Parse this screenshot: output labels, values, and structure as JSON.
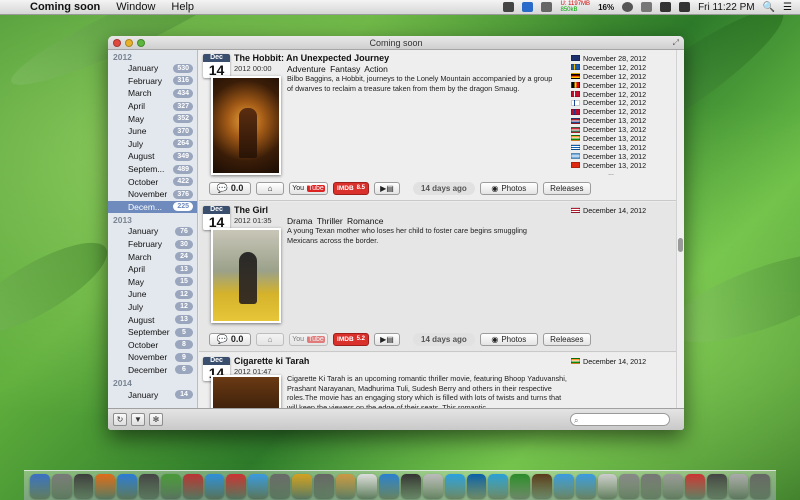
{
  "menubar": {
    "app_name": "Coming soon",
    "menus": [
      "Window",
      "Help"
    ],
    "net_up": "U: 1197MB",
    "net_down": "850kB",
    "battery": "16%",
    "clock": "Fri 11:22 PM"
  },
  "window": {
    "title": "Coming soon"
  },
  "sidebar": {
    "groups": [
      {
        "year": "2012",
        "months": [
          {
            "label": "January",
            "count": "530"
          },
          {
            "label": "February",
            "count": "316"
          },
          {
            "label": "March",
            "count": "434"
          },
          {
            "label": "April",
            "count": "327"
          },
          {
            "label": "May",
            "count": "352"
          },
          {
            "label": "June",
            "count": "370"
          },
          {
            "label": "July",
            "count": "264"
          },
          {
            "label": "August",
            "count": "349"
          },
          {
            "label": "Septem...",
            "count": "489"
          },
          {
            "label": "October",
            "count": "422"
          },
          {
            "label": "November",
            "count": "376"
          },
          {
            "label": "Decem...",
            "count": "225",
            "selected": true
          }
        ]
      },
      {
        "year": "2013",
        "months": [
          {
            "label": "January",
            "count": "76"
          },
          {
            "label": "February",
            "count": "30"
          },
          {
            "label": "March",
            "count": "24"
          },
          {
            "label": "April",
            "count": "13"
          },
          {
            "label": "May",
            "count": "15"
          },
          {
            "label": "June",
            "count": "12"
          },
          {
            "label": "July",
            "count": "12"
          },
          {
            "label": "August",
            "count": "13"
          },
          {
            "label": "September",
            "count": "5"
          },
          {
            "label": "October",
            "count": "8"
          },
          {
            "label": "November",
            "count": "9"
          },
          {
            "label": "December",
            "count": "6"
          }
        ]
      },
      {
        "year": "2014",
        "months": [
          {
            "label": "January",
            "count": "14"
          }
        ]
      }
    ]
  },
  "movies": [
    {
      "month": "Dec",
      "day": "14",
      "title": "The Hobbit: An Unexpected Journey",
      "datetime": "2012 00:00",
      "genres": "Adventure  Fantasy  Action",
      "description": "Bilbo Baggins, a Hobbit, journeys to the Lonely Mountain accompanied by a group of dwarves to reclaim a treasure taken from them by the dragon Smaug.",
      "rating": "0.0",
      "imdb_label": "IMDB",
      "imdb_score": "8.5",
      "days": "14 days ago",
      "photos_label": "Photos",
      "releases_label": "Releases",
      "youtube_you": "You",
      "youtube_tube": "Tube",
      "more": "...",
      "releases": [
        {
          "date": "November 28, 2012",
          "flag": "nz"
        },
        {
          "date": "December 12, 2012",
          "flag": "se"
        },
        {
          "date": "December 12, 2012",
          "flag": "de"
        },
        {
          "date": "December 12, 2012",
          "flag": "be"
        },
        {
          "date": "December 12, 2012",
          "flag": "dk"
        },
        {
          "date": "December 12, 2012",
          "flag": "fi"
        },
        {
          "date": "December 12, 2012",
          "flag": "no"
        },
        {
          "date": "December 13, 2012",
          "flag": "nl"
        },
        {
          "date": "December 13, 2012",
          "flag": "hu"
        },
        {
          "date": "December 13, 2012",
          "flag": "in"
        },
        {
          "date": "December 13, 2012",
          "flag": "gr"
        },
        {
          "date": "December 13, 2012",
          "flag": "ar"
        },
        {
          "date": "December 13, 2012",
          "flag": "hk"
        }
      ]
    },
    {
      "month": "Dec",
      "day": "14",
      "title": "The Girl",
      "datetime": "2012 01:35",
      "genres": "Drama  Thriller  Romance",
      "description": "A young Texan mother who loses her child to foster care begins smuggling Mexicans across the border.",
      "rating": "0.0",
      "imdb_label": "IMDB",
      "imdb_score": "5.2",
      "days": "14 days ago",
      "photos_label": "Photos",
      "releases_label": "Releases",
      "youtube_you": "You",
      "youtube_tube": "Tube",
      "releases": [
        {
          "date": "December 14, 2012",
          "flag": "us"
        }
      ]
    },
    {
      "month": "Dec",
      "day": "14",
      "title": "Cigarette ki Tarah",
      "datetime": "2012 01:47",
      "genres": "",
      "description": "Cigarette Ki Tarah is an upcoming romantic thriller movie, featuring Bhoop Yaduvanshi, Prashant Narayanan, Madhurima Tuli, Sudesh Berry and others in their respective roles.The movie has an engaging story which is filled with lots of twists and turns that will keep the viewers on the edge of their seats. This romantic",
      "releases": [
        {
          "date": "December 14, 2012",
          "flag": "in"
        }
      ]
    }
  ],
  "toolbar": {
    "refresh_icon": "refresh-icon",
    "filter_icon": "filter-icon",
    "settings_icon": "gear-icon",
    "search_placeholder": ""
  },
  "dock_colors": [
    "#3a6fc4",
    "#7a7a7a",
    "#3d3d3d",
    "#e06b1a",
    "#2c7bd6",
    "#444",
    "#4a9a3a",
    "#b33",
    "#2f8fdb",
    "#c33",
    "#3a9ae0",
    "#6a6a6a",
    "#d4a020",
    "#666",
    "#c94",
    "#ddd",
    "#2a7fd0",
    "#333",
    "#bbb",
    "#2aa0e0",
    "#0b5fa8",
    "#2a9fd6",
    "#2a8a2a",
    "#5a3a1a",
    "#3a9ae0",
    "#3a9ae0",
    "#ccc",
    "#888",
    "#777",
    "#999",
    "#c33",
    "#444",
    "#aaa",
    "#666"
  ]
}
